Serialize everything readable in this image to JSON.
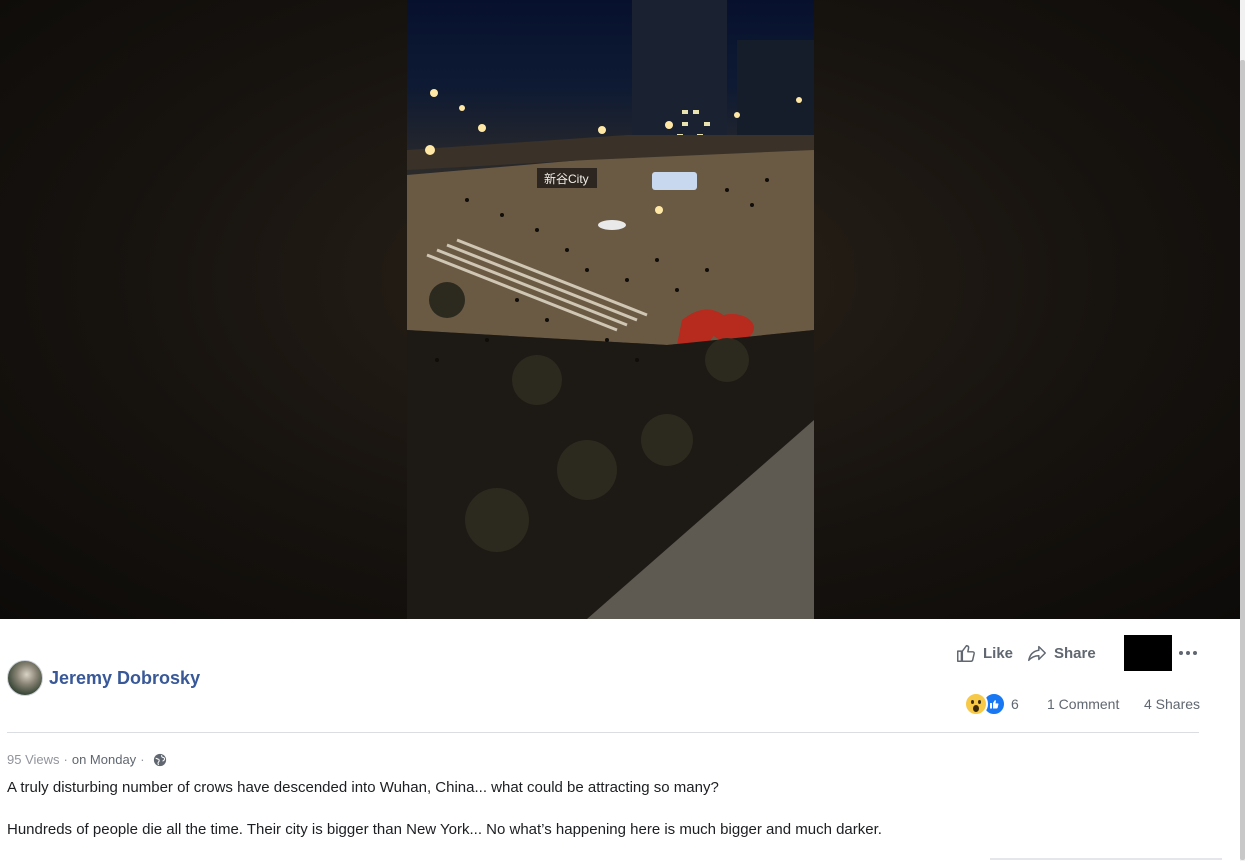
{
  "post": {
    "author_name": "Jeremy Dobrosky",
    "actions": {
      "like_label": "Like",
      "share_label": "Share"
    },
    "reactions": {
      "icons": [
        "wow-reaction-icon",
        "like-reaction-icon"
      ],
      "count": "6"
    },
    "comments_label": "1 Comment",
    "shares_label": "4 Shares",
    "views": "95 Views",
    "date": "on Monday",
    "privacy_icon": "globe-icon",
    "caption_lines": [
      "A truly disturbing number of crows have descended into Wuhan, China... what could be attracting so many?",
      "Hundreds of people die all the time. Their city is bigger than New York... No what’s happening here is much bigger and much darker."
    ]
  },
  "video": {
    "sign_text": "新谷City"
  },
  "colors": {
    "author_link": "#385898",
    "secondary_text": "#606770",
    "muted_text": "#90949c",
    "body_text": "#1c1e21",
    "like_blue": "#1877f2",
    "wow_yellow": "#f7c948"
  }
}
